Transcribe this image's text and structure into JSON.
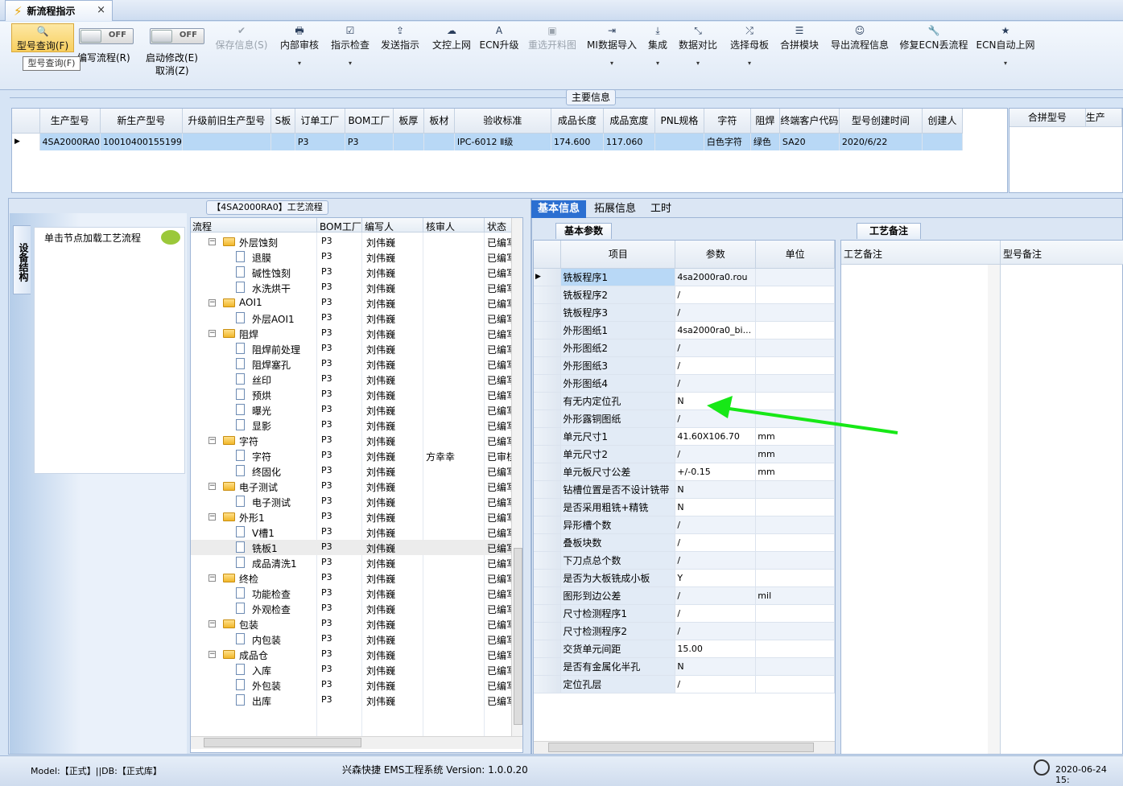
{
  "tab": {
    "title": "新流程指示",
    "close": "×"
  },
  "ribbon": {
    "buttons": [
      {
        "label": "型号查询(F)",
        "icon": "search-icon",
        "glyph": "🔍"
      },
      {
        "label": "编写流程(R)",
        "icon": "toggle",
        "glyph": ""
      },
      {
        "label": "启动修改(E)",
        "icon": "toggle",
        "glyph": ""
      },
      {
        "label": "取消(Z)",
        "icon": "",
        "glyph": ""
      },
      {
        "label": "保存信息(S)",
        "icon": "check-icon",
        "glyph": "✔"
      },
      {
        "label": "内部审核",
        "icon": "printer-icon",
        "glyph": "🖶"
      },
      {
        "label": "指示检查",
        "icon": "checkbox-icon",
        "glyph": "☑"
      },
      {
        "label": "发送指示",
        "icon": "upload-icon",
        "glyph": "⇪"
      },
      {
        "label": "文控上网",
        "icon": "cloud-upload-icon",
        "glyph": "☁"
      },
      {
        "label": "ECN升级",
        "icon": "font-icon",
        "glyph": "A"
      },
      {
        "label": "重选开料图",
        "icon": "image-icon",
        "glyph": "▣"
      },
      {
        "label": "MI数据导入",
        "icon": "import-icon",
        "glyph": "⇥"
      },
      {
        "label": "集成",
        "icon": "download-icon",
        "glyph": "⤓"
      },
      {
        "label": "数据对比",
        "icon": "compress-icon",
        "glyph": "⤡"
      },
      {
        "label": "选择母板",
        "icon": "shuffle-icon",
        "glyph": "⤮"
      },
      {
        "label": "合拼模块",
        "icon": "list-icon",
        "glyph": "☰"
      },
      {
        "label": "导出流程信息",
        "icon": "smile-icon",
        "glyph": "☺"
      },
      {
        "label": "修复ECN丢流程",
        "icon": "wrench-icon",
        "glyph": "🔧"
      },
      {
        "label": "ECN自动上网",
        "icon": "star-icon",
        "glyph": "★"
      }
    ],
    "toggle_off": "OFF",
    "tooltip": "型号查询(F)",
    "dropdown_arrow": "▾"
  },
  "main_info": {
    "title": "主要信息",
    "columns": [
      "生产型号",
      "新生产型号",
      "升级前旧生产型号",
      "S板",
      "订单工厂",
      "BOM工厂",
      "板厚",
      "板材",
      "验收标准",
      "成品长度",
      "成品宽度",
      "PNL规格",
      "字符",
      "阻焊",
      "终端客户代码",
      "型号创建时间",
      "创建人"
    ],
    "row": [
      "4SA2000RA0",
      "10010400155199",
      "",
      "",
      "P3",
      "P3",
      "",
      "",
      "IPC-6012 Ⅱ级",
      "174.600",
      "117.060",
      "",
      "白色字符",
      "绿色",
      "SA20",
      "2020/6/22",
      ""
    ],
    "side_columns": [
      "合拼型号",
      "生产"
    ],
    "row_marker": "▶"
  },
  "process": {
    "title": "【4SA2000RA0】工艺流程",
    "vtab": "设备结构",
    "node_hint": "单击节点加载工艺流程",
    "columns": [
      "流程",
      "BOM工厂",
      "编写人",
      "核审人",
      "状态"
    ],
    "rows": [
      {
        "name": "外层蚀刻",
        "type": "folder",
        "bom": "P3",
        "writer": "刘伟巍",
        "reviewer": "",
        "status": "已编写"
      },
      {
        "name": "退膜",
        "type": "doc",
        "bom": "P3",
        "writer": "刘伟巍",
        "reviewer": "",
        "status": "已编写"
      },
      {
        "name": "碱性蚀刻",
        "type": "doc",
        "bom": "P3",
        "writer": "刘伟巍",
        "reviewer": "",
        "status": "已编写"
      },
      {
        "name": "水洗烘干",
        "type": "doc",
        "bom": "P3",
        "writer": "刘伟巍",
        "reviewer": "",
        "status": "已编写"
      },
      {
        "name": "AOI1",
        "type": "folder",
        "bom": "P3",
        "writer": "刘伟巍",
        "reviewer": "",
        "status": "已编写"
      },
      {
        "name": "外层AOI1",
        "type": "doc",
        "bom": "P3",
        "writer": "刘伟巍",
        "reviewer": "",
        "status": "已编写"
      },
      {
        "name": "阻焊",
        "type": "folder",
        "bom": "P3",
        "writer": "刘伟巍",
        "reviewer": "",
        "status": "已编写"
      },
      {
        "name": "阻焊前处理",
        "type": "doc",
        "bom": "P3",
        "writer": "刘伟巍",
        "reviewer": "",
        "status": "已编写"
      },
      {
        "name": "阻焊塞孔",
        "type": "doc",
        "bom": "P3",
        "writer": "刘伟巍",
        "reviewer": "",
        "status": "已编写"
      },
      {
        "name": "丝印",
        "type": "doc",
        "bom": "P3",
        "writer": "刘伟巍",
        "reviewer": "",
        "status": "已编写"
      },
      {
        "name": "预烘",
        "type": "doc",
        "bom": "P3",
        "writer": "刘伟巍",
        "reviewer": "",
        "status": "已编写"
      },
      {
        "name": "曝光",
        "type": "doc",
        "bom": "P3",
        "writer": "刘伟巍",
        "reviewer": "",
        "status": "已编写"
      },
      {
        "name": "显影",
        "type": "doc",
        "bom": "P3",
        "writer": "刘伟巍",
        "reviewer": "",
        "status": "已编写"
      },
      {
        "name": "字符",
        "type": "folder",
        "bom": "P3",
        "writer": "刘伟巍",
        "reviewer": "",
        "status": "已编写"
      },
      {
        "name": "字符",
        "type": "doc",
        "bom": "P3",
        "writer": "刘伟巍",
        "reviewer": "方幸幸",
        "status": "已审核"
      },
      {
        "name": "终固化",
        "type": "doc",
        "bom": "P3",
        "writer": "刘伟巍",
        "reviewer": "",
        "status": "已编写"
      },
      {
        "name": "电子测试",
        "type": "folder",
        "bom": "P3",
        "writer": "刘伟巍",
        "reviewer": "",
        "status": "已编写"
      },
      {
        "name": "电子测试",
        "type": "doc",
        "bom": "P3",
        "writer": "刘伟巍",
        "reviewer": "",
        "status": "已编写"
      },
      {
        "name": "外形1",
        "type": "folder",
        "bom": "P3",
        "writer": "刘伟巍",
        "reviewer": "",
        "status": "已编写"
      },
      {
        "name": "V槽1",
        "type": "doc",
        "bom": "P3",
        "writer": "刘伟巍",
        "reviewer": "",
        "status": "已编写"
      },
      {
        "name": "铣板1",
        "type": "doc",
        "bom": "P3",
        "writer": "刘伟巍",
        "reviewer": "",
        "status": "已编写",
        "selected": true
      },
      {
        "name": "成品清洗1",
        "type": "doc",
        "bom": "P3",
        "writer": "刘伟巍",
        "reviewer": "",
        "status": "已编写"
      },
      {
        "name": "终检",
        "type": "folder",
        "bom": "P3",
        "writer": "刘伟巍",
        "reviewer": "",
        "status": "已编写"
      },
      {
        "name": "功能检查",
        "type": "doc",
        "bom": "P3",
        "writer": "刘伟巍",
        "reviewer": "",
        "status": "已编写"
      },
      {
        "name": "外观检查",
        "type": "doc",
        "bom": "P3",
        "writer": "刘伟巍",
        "reviewer": "",
        "status": "已编写"
      },
      {
        "name": "包装",
        "type": "folder",
        "bom": "P3",
        "writer": "刘伟巍",
        "reviewer": "",
        "status": "已编写"
      },
      {
        "name": "内包装",
        "type": "doc",
        "bom": "P3",
        "writer": "刘伟巍",
        "reviewer": "",
        "status": "已编写"
      },
      {
        "name": "成品仓",
        "type": "folder",
        "bom": "P3",
        "writer": "刘伟巍",
        "reviewer": "",
        "status": "已编写"
      },
      {
        "name": "入库",
        "type": "doc",
        "bom": "P3",
        "writer": "刘伟巍",
        "reviewer": "",
        "status": "已编写"
      },
      {
        "name": "外包装",
        "type": "doc",
        "bom": "P3",
        "writer": "刘伟巍",
        "reviewer": "",
        "status": "已编写"
      },
      {
        "name": "出库",
        "type": "doc",
        "bom": "P3",
        "writer": "刘伟巍",
        "reviewer": "",
        "status": "已编写"
      }
    ]
  },
  "params": {
    "tabs": [
      "基本信息",
      "拓展信息",
      "工时"
    ],
    "subtab": "基本参数",
    "columns": [
      "项目",
      "参数",
      "单位"
    ],
    "rows": [
      [
        "铣板程序1",
        "4sa2000ra0.rou",
        ""
      ],
      [
        "铣板程序2",
        "/",
        ""
      ],
      [
        "铣板程序3",
        "/",
        ""
      ],
      [
        "外形图纸1",
        "4sa2000ra0_bi...",
        ""
      ],
      [
        "外形图纸2",
        "/",
        ""
      ],
      [
        "外形图纸3",
        "/",
        ""
      ],
      [
        "外形图纸4",
        "/",
        ""
      ],
      [
        "有无内定位孔",
        "N",
        ""
      ],
      [
        "外形露铜图纸",
        "/",
        ""
      ],
      [
        "单元尺寸1",
        "41.60X106.70",
        "mm"
      ],
      [
        "单元尺寸2",
        "/",
        "mm"
      ],
      [
        "单元板尺寸公差",
        "+/-0.15",
        "mm"
      ],
      [
        "钻槽位置是否不设计铣带",
        "N",
        ""
      ],
      [
        "是否采用粗铣+精铣",
        "N",
        ""
      ],
      [
        "异形槽个数",
        "/",
        ""
      ],
      [
        "叠板块数",
        "/",
        ""
      ],
      [
        "下刀点总个数",
        "/",
        ""
      ],
      [
        "是否为大板铣成小板",
        "Y",
        ""
      ],
      [
        "图形到边公差",
        "/",
        "mil"
      ],
      [
        "尺寸检测程序1",
        "/",
        ""
      ],
      [
        "尺寸检测程序2",
        "/",
        ""
      ],
      [
        "交货单元间距",
        "15.00",
        ""
      ],
      [
        "是否有金属化半孔",
        "N",
        ""
      ],
      [
        "定位孔层",
        "/",
        ""
      ]
    ]
  },
  "notes": {
    "tab": "工艺备注",
    "columns": [
      "工艺备注",
      "型号备注"
    ]
  },
  "status": {
    "left": "Model:【正式】||DB:【正式库】",
    "center": "兴森快捷 EMS工程系统 Version: 1.0.0.20",
    "right": "2020-06-24 15:"
  },
  "colors": {
    "accent": "#2b6fd1",
    "selected_row": "#b8d8f6",
    "arrow": "#17e817"
  }
}
